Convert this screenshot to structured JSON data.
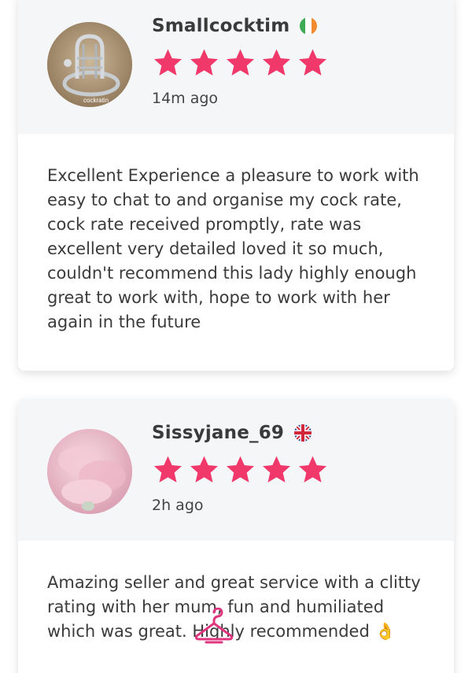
{
  "reviews": [
    {
      "username": "Smallcocktim",
      "flag": "ireland-flag-icon",
      "rating": 5,
      "time": "14m ago",
      "avatar_label": "cockratin",
      "text": "Excellent Experience a pleasure to work with easy to chat to and organise my cock rate, cock rate received promptly, rate was excellent very detailed loved it so much, couldn't recommend this lady highly enough great to work with, hope to work with her again in the future"
    },
    {
      "username": "Sissyjane_69",
      "flag": "uk-flag-icon",
      "rating": 5,
      "time": "2h ago",
      "text": "Amazing seller and great service with a clitty rating with her mum, fun and humiliated which was great. Highly recommended 👌"
    }
  ],
  "colors": {
    "star": "#f0386b",
    "header_bg": "#f5f6f8",
    "text": "#3b3b3b",
    "watermark": "#e0357f"
  },
  "watermark": {
    "icon": "hanger-logo-icon"
  }
}
